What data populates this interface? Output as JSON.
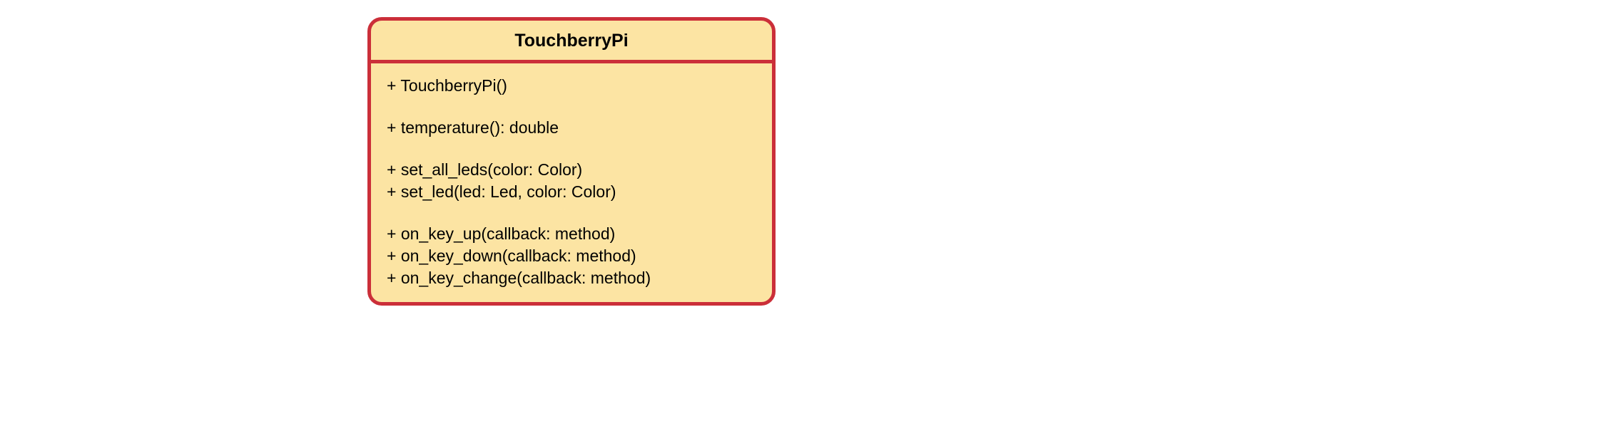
{
  "class": {
    "name": "TouchberryPi",
    "groups": [
      [
        "+ TouchberryPi()"
      ],
      [
        "+ temperature(): double"
      ],
      [
        "+ set_all_leds(color: Color)",
        "+ set_led(led: Led, color: Color)"
      ],
      [
        "+ on_key_up(callback: method)",
        "+ on_key_down(callback: method)",
        "+ on_key_change(callback: method)"
      ]
    ]
  }
}
